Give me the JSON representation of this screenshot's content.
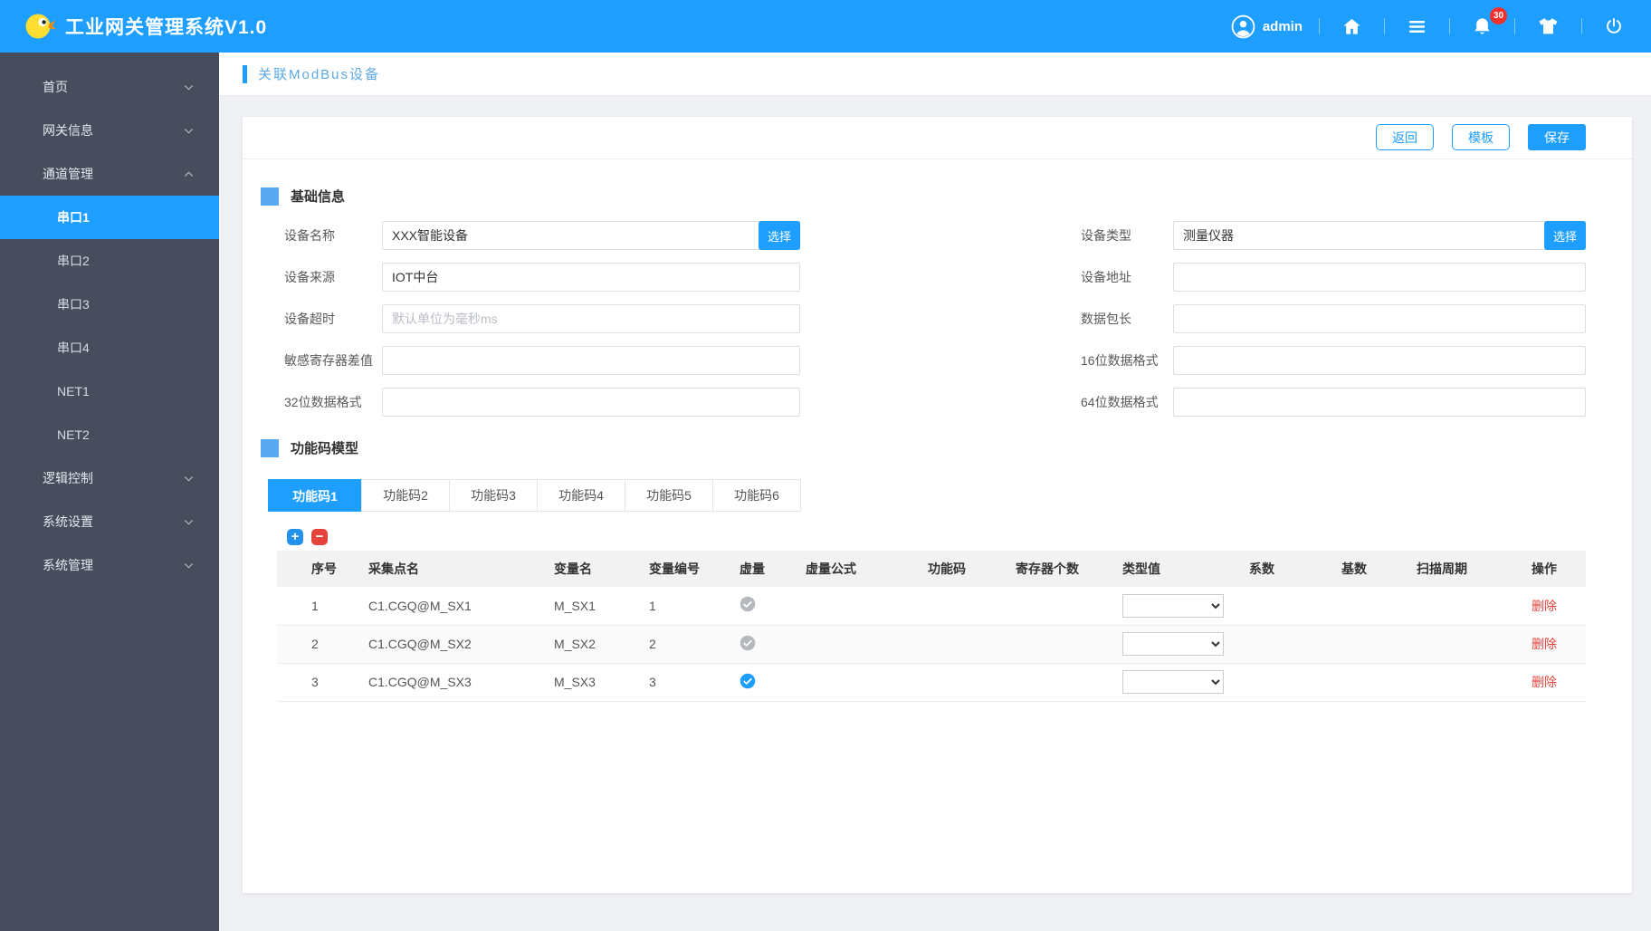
{
  "header": {
    "title": "工业网关管理系统V1.0",
    "username": "admin",
    "badge_count": "30"
  },
  "sidebar": {
    "items": [
      {
        "label": "首页",
        "type": "group",
        "chevron": "down"
      },
      {
        "label": "网关信息",
        "type": "group",
        "chevron": "down"
      },
      {
        "label": "通道管理",
        "type": "group",
        "chevron": "up"
      },
      {
        "label": "串口1",
        "type": "sub",
        "active": true
      },
      {
        "label": "串口2",
        "type": "sub",
        "active": false
      },
      {
        "label": "串口3",
        "type": "sub",
        "active": false
      },
      {
        "label": "串口4",
        "type": "sub",
        "active": false
      },
      {
        "label": "NET1",
        "type": "sub",
        "active": false
      },
      {
        "label": "NET2",
        "type": "sub",
        "active": false
      },
      {
        "label": "逻辑控制",
        "type": "group",
        "chevron": "down"
      },
      {
        "label": "系统设置",
        "type": "group",
        "chevron": "down"
      },
      {
        "label": "系统管理",
        "type": "group",
        "chevron": "down"
      }
    ]
  },
  "page": {
    "title": "关联ModBus设备"
  },
  "toolbar": {
    "back": "返回",
    "template": "模板",
    "save": "保存"
  },
  "basic_info": {
    "section_title": "基础信息",
    "fields_left": [
      {
        "label": "设备名称",
        "value": "XXX智能设备",
        "button": "选择"
      },
      {
        "label": "设备来源",
        "value": "IOT中台"
      },
      {
        "label": "设备超时",
        "value": "",
        "placeholder": "默认单位为毫秒ms"
      },
      {
        "label": "敏感寄存器差值",
        "value": ""
      },
      {
        "label": "32位数据格式",
        "value": ""
      }
    ],
    "fields_right": [
      {
        "label": "设备类型",
        "value": "测量仪器",
        "button": "选择"
      },
      {
        "label": "设备地址",
        "value": ""
      },
      {
        "label": "数据包长",
        "value": ""
      },
      {
        "label": "16位数据格式",
        "value": ""
      },
      {
        "label": "64位数据格式",
        "value": ""
      }
    ]
  },
  "function_code": {
    "section_title": "功能码模型",
    "tabs": [
      "功能码1",
      "功能码2",
      "功能码3",
      "功能码4",
      "功能码5",
      "功能码6"
    ],
    "active_tab_index": 0,
    "tools": {
      "add": "+",
      "remove": "−"
    },
    "table": {
      "headers": [
        "序号",
        "采集点名",
        "变量名",
        "变量编号",
        "虚量",
        "虚量公式",
        "功能码",
        "寄存器个数",
        "类型值",
        "系数",
        "基数",
        "扫描周期",
        "操作"
      ],
      "delete_label": "删除",
      "rows": [
        {
          "index": "1",
          "point_name": "C1.CGQ@M_SX1",
          "var_name": "M_SX1",
          "var_no": "1",
          "virtual": "checked-gray"
        },
        {
          "index": "2",
          "point_name": "C1.CGQ@M_SX2",
          "var_name": "M_SX2",
          "var_no": "2",
          "virtual": "checked-gray"
        },
        {
          "index": "3",
          "point_name": "C1.CGQ@M_SX3",
          "var_name": "M_SX3",
          "var_no": "3",
          "virtual": "checked-blue"
        }
      ]
    }
  },
  "colors": {
    "accent": "#1E9FFF",
    "sidebar_bg": "#474D5D",
    "danger": "#E5443C",
    "badge": "#F4302C",
    "table_header_bg": "#F2F2F2",
    "page_bg": "#EFF1F4"
  }
}
